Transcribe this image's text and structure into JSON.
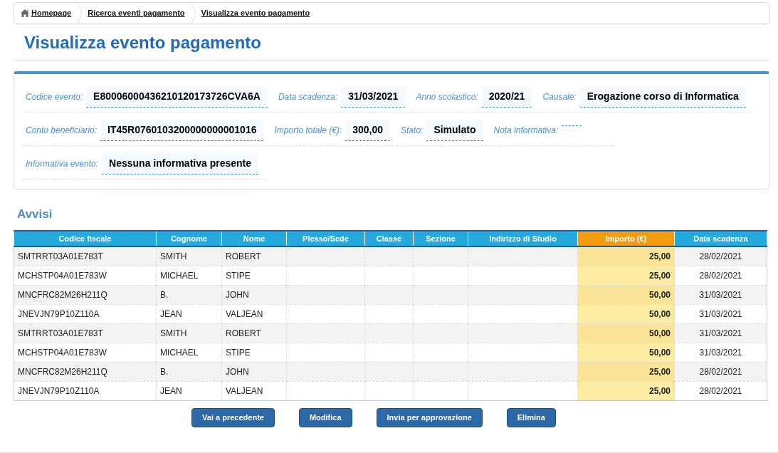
{
  "breadcrumb": [
    {
      "label": "Homepage",
      "kind": "home"
    },
    {
      "label": "Ricerca eventi pagamento",
      "kind": "link"
    },
    {
      "label": "Visualizza evento pagamento",
      "kind": "link"
    }
  ],
  "title": "Visualizza evento pagamento",
  "details": [
    [
      {
        "label": "Codice evento:",
        "value": "E80006000436210120173726CVA6A"
      },
      {
        "label": "Data scadenza:",
        "value": "31/03/2021"
      },
      {
        "label": "Anno scolastico:",
        "value": "2020/21"
      },
      {
        "label": "Causale:",
        "value": "Erogazione corso di Informatica"
      }
    ],
    [
      {
        "label": "Conto beneficiario:",
        "value": "IT45R0760103200000000001016"
      },
      {
        "label": "Importo totale (€):",
        "value": "300,00"
      },
      {
        "label": "Stato:",
        "value": "Simulato"
      },
      {
        "label": "Nota informativa:"
      }
    ],
    [
      {
        "label": "Informativa evento:",
        "value": "Nessuna informativa presente"
      }
    ]
  ],
  "section_title": "Avvisi",
  "table": {
    "columns": [
      {
        "label": "Codice fiscale",
        "kind": "text"
      },
      {
        "label": "Cognome",
        "kind": "text"
      },
      {
        "label": "Nome",
        "kind": "text"
      },
      {
        "label": "Plesso/Sede",
        "kind": "text"
      },
      {
        "label": "Classe",
        "kind": "text"
      },
      {
        "label": "Sezione",
        "kind": "text"
      },
      {
        "label": "Indirizzo di Studio",
        "kind": "text"
      },
      {
        "label": "Importo (€)",
        "kind": "amount"
      },
      {
        "label": "Data scadenza",
        "kind": "date"
      }
    ],
    "rows": [
      [
        "SMTRRT03A01E783T",
        "SMITH",
        "ROBERT",
        "",
        "",
        "",
        "",
        "25,00",
        "28/02/2021"
      ],
      [
        "MCHSTP04A01E783W",
        "MICHAEL",
        "STIPE",
        "",
        "",
        "",
        "",
        "25,00",
        "28/02/2021"
      ],
      [
        "MNCFRC82M26H211Q",
        "B.",
        "JOHN",
        "",
        "",
        "",
        "",
        "50,00",
        "31/03/2021"
      ],
      [
        "JNEVJN79P10Z110A",
        "JEAN",
        "VALJEAN",
        "",
        "",
        "",
        "",
        "50,00",
        "31/03/2021"
      ],
      [
        "SMTRRT03A01E783T",
        "SMITH",
        "ROBERT",
        "",
        "",
        "",
        "",
        "50,00",
        "31/03/2021"
      ],
      [
        "MCHSTP04A01E783W",
        "MICHAEL",
        "STIPE",
        "",
        "",
        "",
        "",
        "50,00",
        "31/03/2021"
      ],
      [
        "MNCFRC82M26H211Q",
        "B.",
        "JOHN",
        "",
        "",
        "",
        "",
        "25,00",
        "28/02/2021"
      ],
      [
        "JNEVJN79P10Z110A",
        "JEAN",
        "VALJEAN",
        "",
        "",
        "",
        "",
        "25,00",
        "28/02/2021"
      ]
    ]
  },
  "buttons": [
    "Vai a precedente",
    "Modifica",
    "Invia per approvazione",
    "Elimina"
  ]
}
